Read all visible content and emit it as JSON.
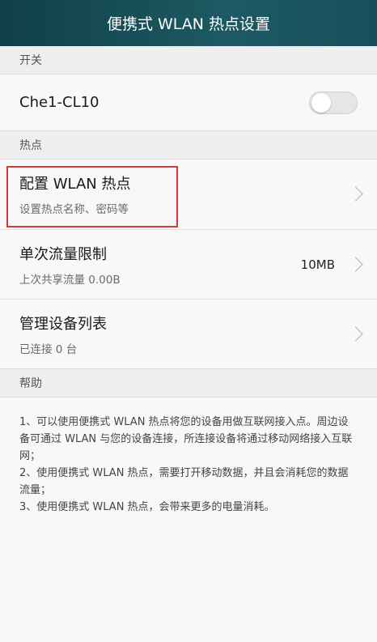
{
  "header": {
    "title": "便携式 WLAN 热点设置"
  },
  "sections": {
    "switch": "开关",
    "hotspot": "热点",
    "help": "帮助"
  },
  "switch_row": {
    "label": "Che1-CL10",
    "enabled": false
  },
  "rows": [
    {
      "title": "配置 WLAN 热点",
      "subtitle": "设置热点名称、密码等",
      "value": ""
    },
    {
      "title": "单次流量限制",
      "subtitle": "上次共享流量 0.00B",
      "value": "10MB"
    },
    {
      "title": "管理设备列表",
      "subtitle": "已连接 0 台",
      "value": ""
    }
  ],
  "help_lines": [
    "1、可以使用便携式 WLAN 热点将您的设备用做互联网接入点。周边设备可通过 WLAN 与您的设备连接，所连接设备将通过移动网络接入互联网；",
    "2、使用便携式 WLAN 热点，需要打开移动数据，并且会消耗您的数据流量；",
    "3、使用便携式 WLAN 热点，会带来更多的电量消耗。"
  ],
  "colors": {
    "titlebar": "#17505a",
    "highlight": "#d23a3a"
  },
  "icons": {
    "chevron": "chevron-right-icon"
  }
}
